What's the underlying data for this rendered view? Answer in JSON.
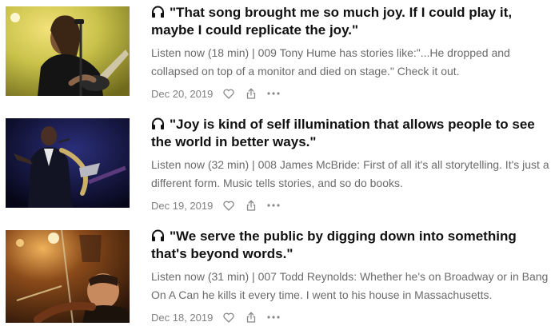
{
  "posts": [
    {
      "title": "\"That song brought me so much joy. If I could play it, maybe I could replicate the joy.\"",
      "excerpt": "Listen now (18 min) | 009 Tony Hume has stories like:\"...He dropped and collapsed on top of a monitor and died on stage.\" Check it out.",
      "date": "Dec 20, 2019",
      "image": "guitarist-with-microphone"
    },
    {
      "title": "\"Joy is kind of self illumination that allows people to see the world in better ways.\"",
      "excerpt": "Listen now (32 min) | 008 James McBride: First of all it's all storytelling. It's just a different form. Music tells stories, and so do books.",
      "date": "Dec 19, 2019",
      "image": "saxophonist-on-stage"
    },
    {
      "title": "\"We serve the public by digging down into something that's beyond words.\"",
      "excerpt": "Listen now (31 min) | 007 Todd Reynolds: Whether he's on Broadway or in Bang On A Can he kills it every time. I went to his house in Massachusetts.",
      "date": "Dec 18, 2019",
      "image": "violinist-performing"
    }
  ],
  "icons": {
    "title_icon": "headphones-icon",
    "like": "heart-icon",
    "share": "share-icon",
    "more": "more-icon"
  },
  "colors": {
    "title": "#111111",
    "text_secondary": "#6b6b6b",
    "meta": "#808080"
  }
}
